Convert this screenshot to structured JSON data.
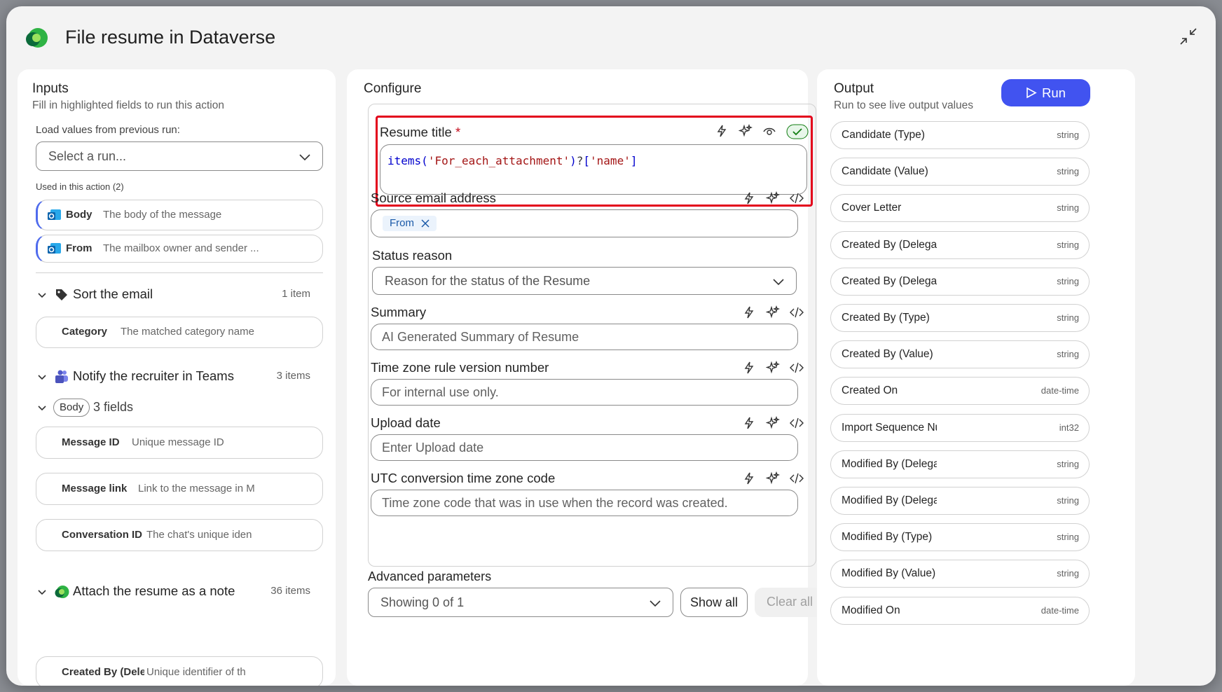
{
  "dialog": {
    "title": "File resume in Dataverse"
  },
  "inputs": {
    "heading": "Inputs",
    "subtitle": "Fill in highlighted fields to run this action",
    "load_label": "Load values from previous run:",
    "run_select_placeholder": "Select a run...",
    "used_label": "Used in this action (2)",
    "used_items": [
      {
        "label": "Body",
        "value": "The body of the message"
      },
      {
        "label": "From",
        "value": "The mailbox owner and sender ..."
      }
    ],
    "sections": [
      {
        "title": "Sort the email",
        "count": "1 item",
        "icon": "tag-icon"
      },
      {
        "title": "Notify the recruiter in Teams",
        "count": "3 items",
        "icon": "teams-icon"
      },
      {
        "title": "Attach the resume as a note",
        "count": "36 items",
        "icon": "dataverse-icon"
      }
    ],
    "sort_fields": [
      {
        "label": "Category",
        "value": "The matched category name"
      }
    ],
    "body_tag": "Body",
    "body_fields_count": "3 fields",
    "teams_fields": [
      {
        "label": "Message ID",
        "value": "Unique message ID"
      },
      {
        "label": "Message link",
        "value": "Link to the message in M"
      },
      {
        "label": "Conversation ID",
        "value": "The chat's unique iden"
      }
    ],
    "note_fields": [
      {
        "label": "Created By (Dele",
        "value": "Unique identifier of th"
      }
    ]
  },
  "configure": {
    "heading": "Configure",
    "resume_title": {
      "label": "Resume title",
      "required": "*",
      "expr": {
        "fn": "items",
        "p1": "(",
        "arg": "'For_each_attachment'",
        "p2": ")",
        "op": "?",
        "b1": "[",
        "key": "'name'",
        "b2": "]"
      }
    },
    "source_email": {
      "label": "Source email address",
      "chip": "From"
    },
    "status_reason": {
      "label": "Status reason",
      "placeholder": "Reason for the status of the Resume"
    },
    "summary": {
      "label": "Summary",
      "placeholder": "AI Generated Summary of Resume"
    },
    "tz_rule": {
      "label": "Time zone rule version number",
      "placeholder": "For internal use only."
    },
    "upload_date": {
      "label": "Upload date",
      "placeholder": "Enter Upload date"
    },
    "utc_code": {
      "label": "UTC conversion time zone code",
      "placeholder": "Time zone code that was in use when the record was created."
    },
    "advanced": {
      "label": "Advanced parameters",
      "showing": "Showing 0 of 1",
      "show_all": "Show all",
      "clear_all": "Clear all"
    }
  },
  "output": {
    "heading": "Output",
    "subtitle": "Run to see live output values",
    "run_label": "Run",
    "rows": [
      {
        "name": "Candidate (Type)",
        "type": "string"
      },
      {
        "name": "Candidate (Value)",
        "type": "string"
      },
      {
        "name": "Cover Letter",
        "type": "string"
      },
      {
        "name": "Created By (Delegat",
        "type": "string"
      },
      {
        "name": "Created By (Delegat",
        "type": "string"
      },
      {
        "name": "Created By (Type)",
        "type": "string"
      },
      {
        "name": "Created By (Value)",
        "type": "string"
      },
      {
        "name": "Created On",
        "type": "date-time"
      },
      {
        "name": "Import Sequence Nu",
        "type": "int32"
      },
      {
        "name": "Modified By (Delega",
        "type": "string"
      },
      {
        "name": "Modified By (Delega",
        "type": "string"
      },
      {
        "name": "Modified By (Type)",
        "type": "string"
      },
      {
        "name": "Modified By (Value)",
        "type": "string"
      },
      {
        "name": "Modified On",
        "type": "date-time"
      }
    ]
  },
  "colors": {
    "accent": "#4153f0",
    "highlight_border": "#e3001b",
    "check": "#107c10"
  }
}
